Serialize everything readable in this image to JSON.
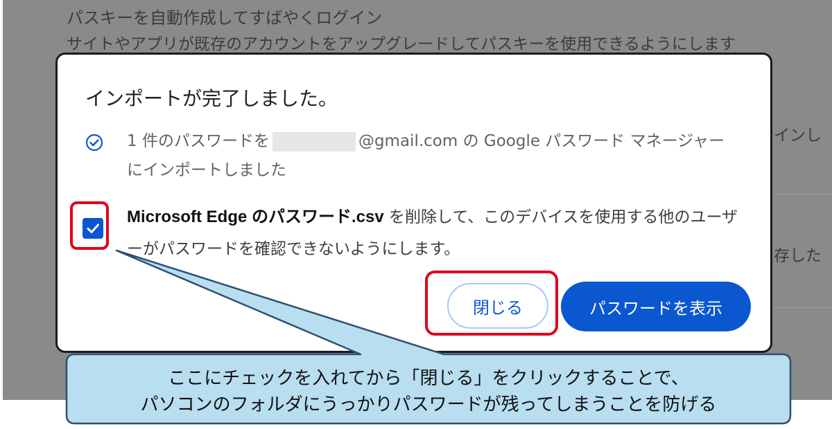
{
  "background": {
    "heading": "パスキーを自動作成してすばやくログイン",
    "subtext": "サイトやアプリが既存のアカウントをアップグレードしてパスキーを使用できるようにします",
    "right_fragment_1": "インし",
    "right_fragment_2": "存した"
  },
  "dialog": {
    "title": "インポートが完了しました。",
    "message_prefix": "1 件のパスワードを",
    "message_suffix": "@gmail.com の Google パスワード マネージャー にインポートしました",
    "delete_checkbox": {
      "checked": true,
      "file_name": "Microsoft Edge のパスワード.csv",
      "description": " を削除して、このデバイスを使用する他のユーザーがパスワードを確認できないようにします。"
    },
    "close_label": "閉じる",
    "show_passwords_label": "パスワードを表示"
  },
  "callout": {
    "line1": "ここにチェックを入れてから「閉じる」をクリックすることで、",
    "line2": "パソコンのフォルダにうっかりパスワードが残ってしまうことを防げる"
  },
  "colors": {
    "accent": "#0b57d0",
    "highlight": "#e0001b",
    "callout_fill": "#b8def0",
    "callout_border": "#2f4f6f"
  },
  "icons": {
    "success": "check-circle-icon",
    "checkbox": "checkmark-icon"
  }
}
